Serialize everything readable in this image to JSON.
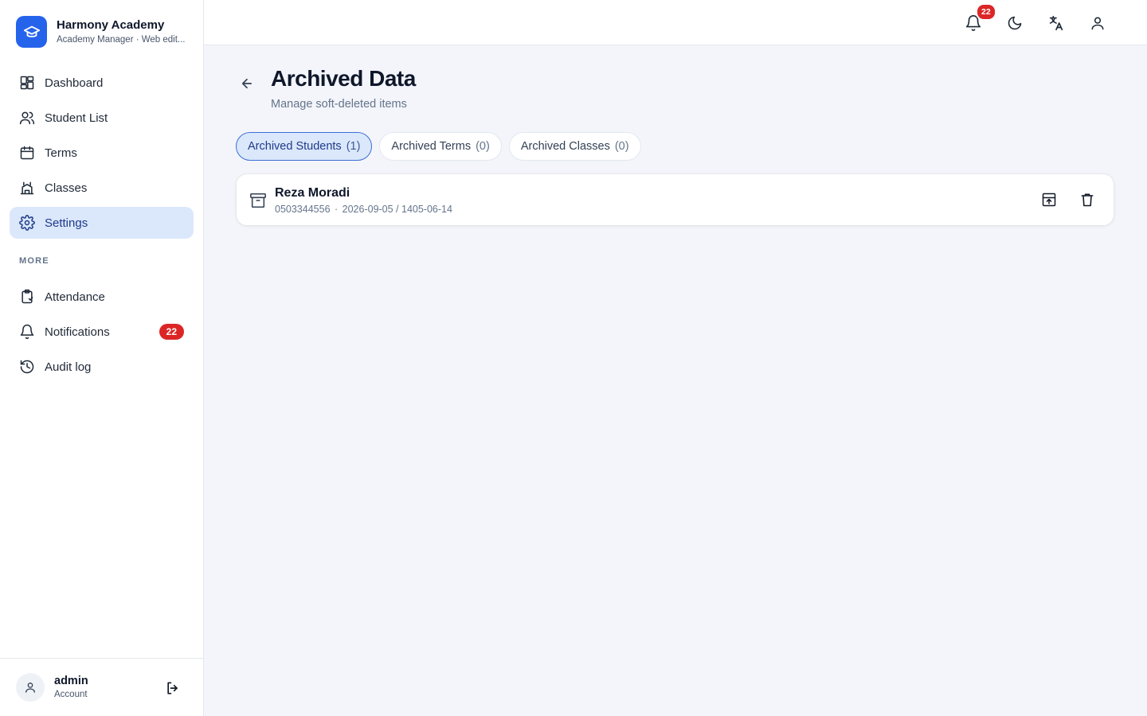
{
  "brand": {
    "title": "Harmony Academy",
    "subtitle": "Academy Manager · Web edit..."
  },
  "sidebar": {
    "items": [
      {
        "label": "Dashboard",
        "icon": "dashboard-icon"
      },
      {
        "label": "Student List",
        "icon": "users-icon"
      },
      {
        "label": "Terms",
        "icon": "calendar-icon"
      },
      {
        "label": "Classes",
        "icon": "building-icon"
      },
      {
        "label": "Settings",
        "icon": "gear-icon",
        "active": true
      }
    ],
    "more_label": "MORE",
    "more_items": [
      {
        "label": "Attendance",
        "icon": "clipboard-icon"
      },
      {
        "label": "Notifications",
        "icon": "bell-icon",
        "badge": "22"
      },
      {
        "label": "Audit log",
        "icon": "history-icon"
      }
    ]
  },
  "user": {
    "name": "admin",
    "role": "Account"
  },
  "topbar": {
    "notification_count": "22",
    "icons": [
      "bell-icon",
      "moon-icon",
      "translate-icon",
      "user-icon"
    ]
  },
  "page": {
    "title": "Archived Data",
    "subtitle": "Manage soft-deleted items"
  },
  "tabs": [
    {
      "label": "Archived Students",
      "count": "(1)",
      "active": true
    },
    {
      "label": "Archived Terms",
      "count": "(0)"
    },
    {
      "label": "Archived Classes",
      "count": "(0)"
    }
  ],
  "archived_students": [
    {
      "name": "Reza Moradi",
      "phone": "0503344556",
      "date": "2026-09-05 / 1405-06-14"
    }
  ],
  "colors": {
    "accent": "#2563eb",
    "active_bg": "#dbe7fb",
    "badge": "#dc2626"
  }
}
